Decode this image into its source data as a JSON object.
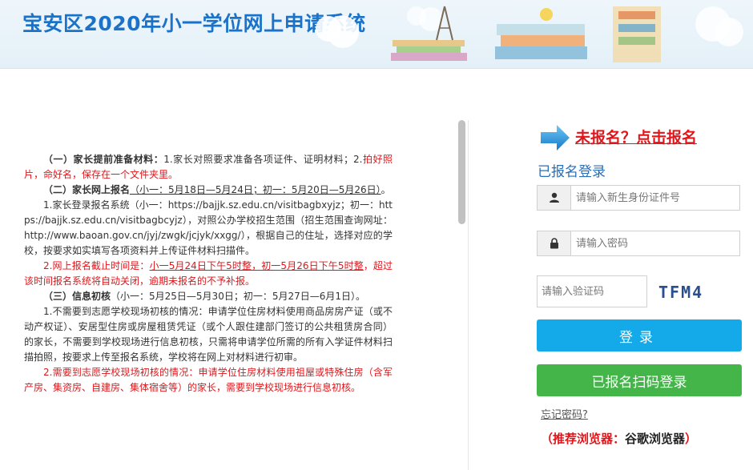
{
  "header": {
    "title": "宝安区2020年小一学位网上申请系统"
  },
  "notice": {
    "p1": {
      "head": "（一）家长提前准备材料：",
      "body": "1.家长对照要求准备各项证件、证明材料；2.",
      "red": "拍好照片，命好名，保存在一个文件夹里。"
    },
    "p2": {
      "head": "（二）家长网上报名",
      "dates": "（小一：5月18日—5月24日；初一：5月20日—5月26日）",
      "tail": "。"
    },
    "p3": "1.家长登录报名系统（小一：https://bajjk.sz.edu.cn/visitbagbxyjz；初一：https://bajjk.sz.edu.cn/visitbagbcyjz），对照公办学校招生范围（招生范围查询网址：http://www.baoan.gov.cn/jyj/zwgk/jcjyk/xxgg/），根据自己的住址，选择对应的学校，按要求如实填写各项资料并上传证件材料扫描件。",
    "p4": {
      "head": "2.网上报名截止时间是：",
      "deadline": "小一5月24日下午5时整，初一5月26日下午5时整",
      "tail": "，超过该时间报名系统将自动关闭，逾期未报名的不予补报。"
    },
    "p5": {
      "head": "（三）信息初核",
      "dates": "（小一：5月25日—5月30日；初一：5月27日—6月1日）。"
    },
    "p6": "1.不需要到志愿学校现场初核的情况：申请学位住房材料使用商品房房产证（或不动产权证）、安居型住房或房屋租赁凭证（或个人跟住建部门签订的公共租赁房合同）的家长，不需要到学校现场进行信息初核，只需将申请学位所需的所有入学证件材料扫描拍照，按要求上传至报名系统，学校将在网上对材料进行初审。",
    "p7": "2.需要到志愿学校现场初核的情况：申请学位住房材料使用祖屋或特殊住房（含军产房、集资房、自建房、集体宿舍等）的家长，需要到学校现场进行信息初核。"
  },
  "login": {
    "register_link": "未报名？点击报名",
    "heading": "已报名登录",
    "id_placeholder": "请输入新生身份证件号",
    "pwd_placeholder": "请输入密码",
    "captcha_placeholder": "请输入验证码",
    "captcha_text": "TFM4",
    "login_button": "登录",
    "scan_button": "已报名扫码登录",
    "forgot_link": "忘记密码?",
    "browser_tip_prefix": "（推荐浏览器：",
    "browser_tip_name": "谷歌浏览器",
    "browser_tip_suffix": "）"
  },
  "colors": {
    "title_blue": "#1a73c9",
    "alert_red": "#e0161b",
    "login_blue": "#14a9e9",
    "scan_green": "#44b549"
  }
}
